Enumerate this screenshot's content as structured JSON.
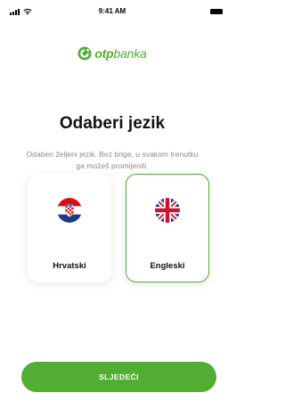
{
  "status_bar": {
    "time": "9:41 AM"
  },
  "brand": {
    "name_bold": "otp",
    "name_rest": "banka",
    "accent_color": "#52ae32",
    "logo_icon": "otp-logo-icon"
  },
  "heading": {
    "title": "Odaberi jezik",
    "subtitle": "Odaberi željeni jezik. Bez brige, u svakom trenutku ga možeš promijeniti."
  },
  "languages": [
    {
      "label": "Hrvatski",
      "flag_icon": "croatia-flag-icon",
      "selected": false
    },
    {
      "label": "Engleski",
      "flag_icon": "uk-flag-icon",
      "selected": true
    }
  ],
  "footer": {
    "next_label": "SLJEDEĆI"
  }
}
